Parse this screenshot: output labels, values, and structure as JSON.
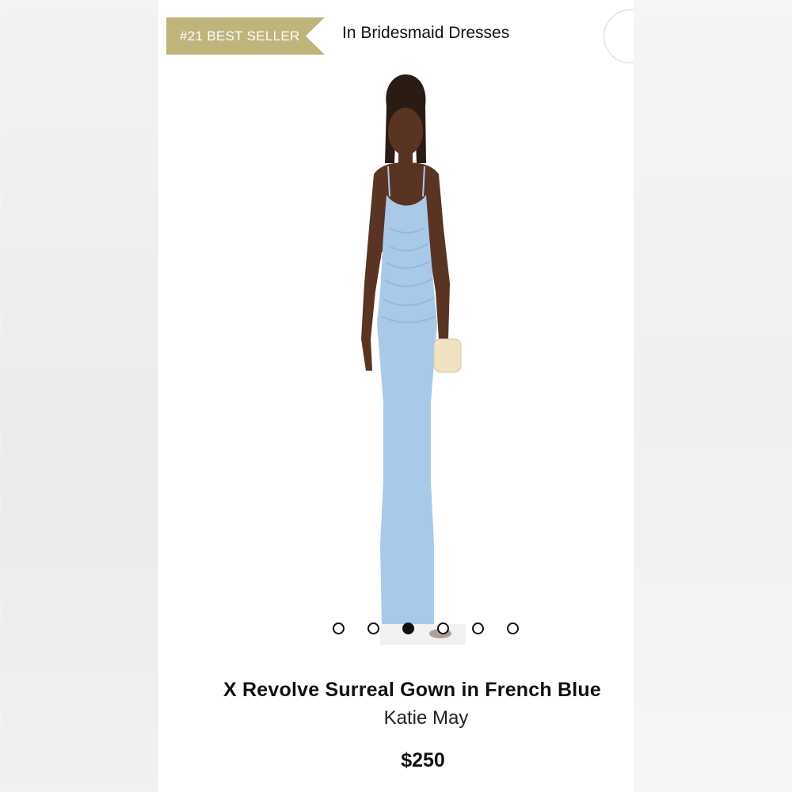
{
  "header": {
    "badge_label": "#21 BEST SELLER",
    "category_label": "In Bridesmaid Dresses"
  },
  "product": {
    "title": "X Revolve Surreal Gown in French Blue",
    "brand": "Katie May",
    "price": "$250",
    "image_alt": "Model wearing a light blue cowl-neck maxi gown holding a cream clutch",
    "dress_color": "#a9c9e8"
  },
  "carousel": {
    "total_slides": 6,
    "active_index": 2
  },
  "colors": {
    "badge_bg": "#bfb47c",
    "text": "#111111"
  }
}
